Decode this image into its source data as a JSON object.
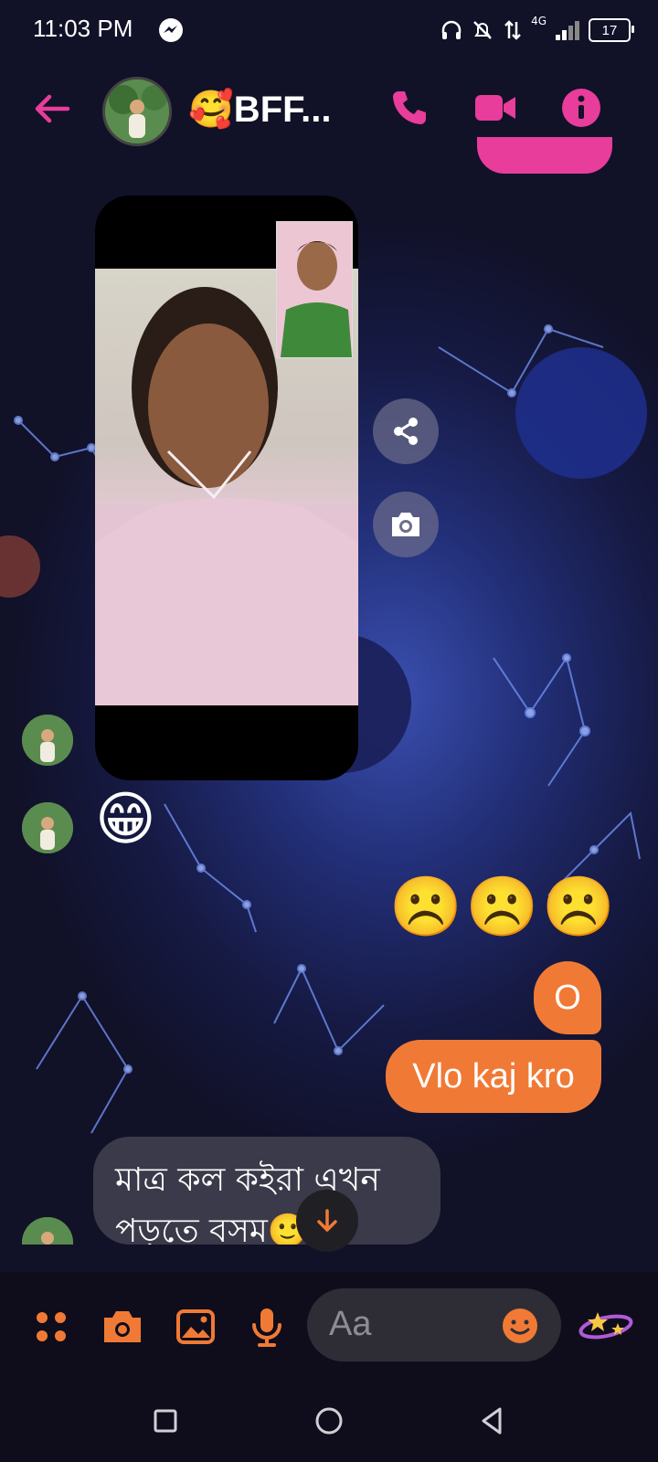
{
  "status_bar": {
    "time": "11:03 PM",
    "network": "4G",
    "battery": "17"
  },
  "header": {
    "title": "🥰BFF..."
  },
  "messages": {
    "grin_emoji": "😁",
    "sad_emojis": "☹️☹️☹️",
    "out_1": "O",
    "out_2": "Vlo kaj kro",
    "in_text": "মাত্র কল কইরা এখন পড়তে বসম🙂"
  },
  "composer": {
    "placeholder": "Aa"
  },
  "colors": {
    "accent_pink": "#e83d9a",
    "accent_orange": "#f07a35",
    "background": "#12122a"
  }
}
